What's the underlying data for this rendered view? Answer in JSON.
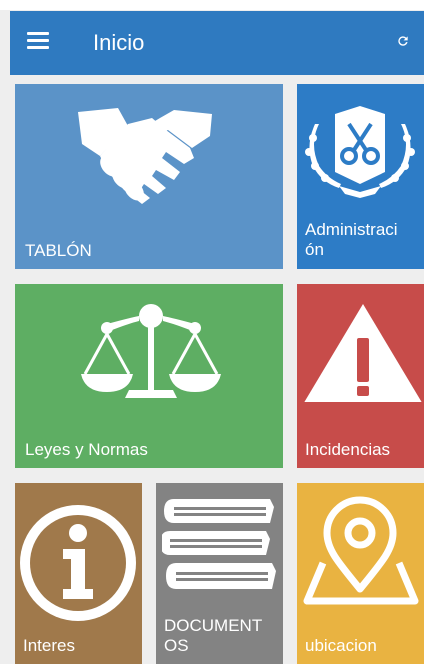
{
  "appbar": {
    "title": "Inicio",
    "color": "#2f7ac0"
  },
  "icons": {
    "menu": "menu-icon",
    "refresh": "refresh-icon"
  },
  "tiles": [
    {
      "label": "TABLÓN",
      "icon": "handshake-icon",
      "color": "#5b93c8"
    },
    {
      "label": "Administraci\nón",
      "icon": "keys-emblem-icon",
      "color": "#2d7cc6"
    },
    {
      "label": "Leyes y Normas",
      "icon": "scales-icon",
      "color": "#5eae63"
    },
    {
      "label": "Incidencias",
      "icon": "warning-icon",
      "color": "#c74c4a"
    },
    {
      "label": "Interes",
      "icon": "info-icon",
      "color": "#a0794b"
    },
    {
      "label": "DOCUMENT\nOS",
      "icon": "books-icon",
      "color": "#838383"
    },
    {
      "label": "ubicacion",
      "icon": "map-pin-icon",
      "color": "#e9b341"
    }
  ]
}
